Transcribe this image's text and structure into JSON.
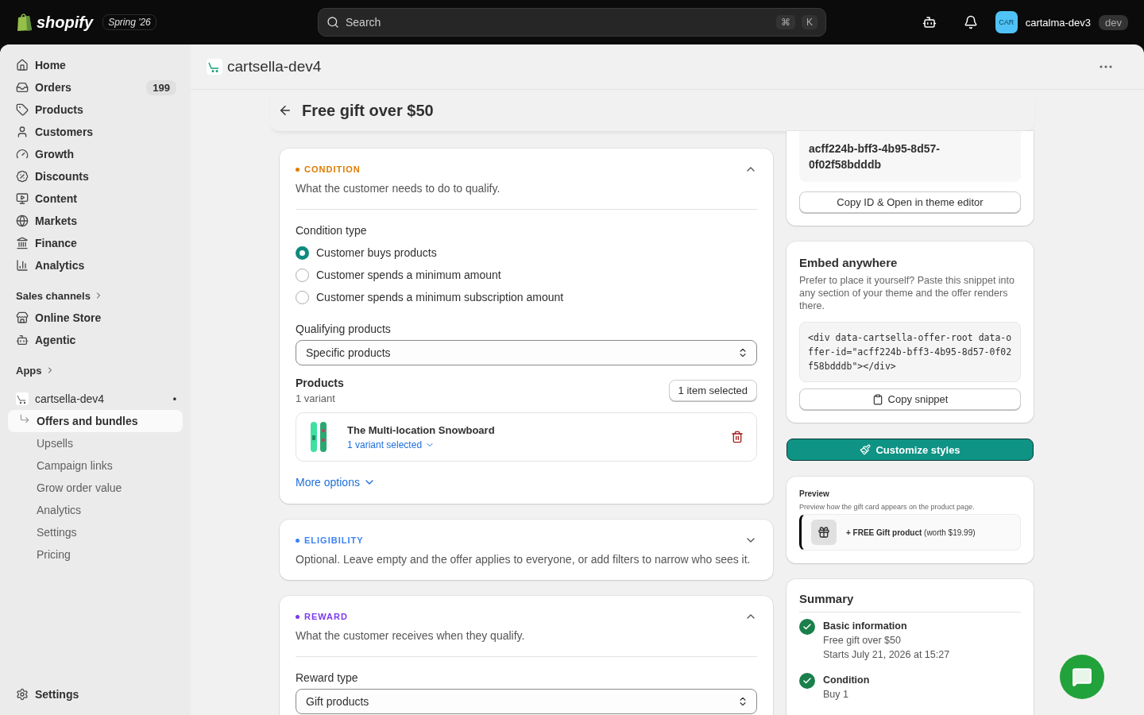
{
  "topbar": {
    "logo_text": "shopify",
    "edition": "Spring '26",
    "search": {
      "placeholder": "Search"
    },
    "shortcut": [
      "⌘",
      "K"
    ],
    "account": {
      "initials": "CAR",
      "store": "cartalma-dev3",
      "badge": "dev"
    }
  },
  "sidebar": {
    "items": [
      {
        "label": "Home"
      },
      {
        "label": "Orders",
        "badge": "199"
      },
      {
        "label": "Products"
      },
      {
        "label": "Customers"
      },
      {
        "label": "Growth"
      },
      {
        "label": "Discounts"
      },
      {
        "label": "Content"
      },
      {
        "label": "Markets"
      },
      {
        "label": "Finance"
      },
      {
        "label": "Analytics"
      }
    ],
    "sales_channels": {
      "heading": "Sales channels",
      "items": [
        {
          "label": "Online Store"
        },
        {
          "label": "Agentic"
        }
      ]
    },
    "apps": {
      "heading": "Apps",
      "app": {
        "name": "cartsella-dev4",
        "dot": "•"
      },
      "children": [
        {
          "label": "Offers and bundles",
          "selected": true
        },
        {
          "label": "Upsells",
          "selected": false
        },
        {
          "label": "Campaign links",
          "selected": false
        },
        {
          "label": "Grow order value",
          "selected": false
        },
        {
          "label": "Analytics",
          "selected": false
        },
        {
          "label": "Settings",
          "selected": false
        },
        {
          "label": "Pricing",
          "selected": false
        }
      ]
    },
    "footer": {
      "label": "Settings"
    }
  },
  "app_header": {
    "title": "cartsella-dev4"
  },
  "page": {
    "title": "Free gift over $50"
  },
  "sections": [
    {
      "kind": "condition",
      "label": "CONDITION",
      "color": "#e07b00",
      "expanded": true,
      "description": "What the customer needs to do to qualify.",
      "condition_type": {
        "label": "Condition type",
        "options": [
          {
            "label": "Customer buys products",
            "selected": true
          },
          {
            "label": "Customer spends a minimum amount",
            "selected": false
          },
          {
            "label": "Customer spends a minimum subscription amount",
            "selected": false
          }
        ]
      },
      "qualifying": {
        "label": "Qualifying products",
        "value": "Specific products"
      },
      "products": {
        "heading": "Products",
        "count": "1 variant",
        "button": "1 item selected",
        "items": [
          {
            "name": "The Multi-location Snowboard",
            "variant": "1 variant selected"
          }
        ]
      },
      "more_options": "More options"
    },
    {
      "kind": "eligibility",
      "label": "ELIGIBILITY",
      "color": "#3b82f6",
      "expanded": false,
      "description": "Optional. Leave empty and the offer applies to everyone, or add filters to narrow who sees it."
    },
    {
      "kind": "reward",
      "label": "REWARD",
      "color": "#7c3aed",
      "expanded": true,
      "description": "What the customer receives when they qualify.",
      "reward_type": {
        "label": "Reward type",
        "value": "Gift products"
      }
    }
  ],
  "theme_block": {
    "offer_id": "acff224b-bff3-4b95-8d57-0f02f58bdddb",
    "button": "Copy ID & Open in theme editor"
  },
  "embed": {
    "title": "Embed anywhere",
    "description": "Prefer to place it yourself? Paste this snippet into any section of your theme and the offer renders there.",
    "snippet": "<div data-cartsella-offer-root data-offer-id=\"acff224b-bff3-4b95-8d57-0f02f58bdddb\"></div>",
    "button": "Copy snippet"
  },
  "customize": {
    "label": "Customize styles"
  },
  "preview": {
    "title": "Preview",
    "description": "Preview how the gift card appears on the product page.",
    "gift_text": "**+ FREE Gift product** (worth $19.99)"
  },
  "summary": {
    "title": "Summary",
    "steps": [
      {
        "title": "Basic information",
        "done": true,
        "lines": [
          "Free gift over $50",
          "Starts July 21, 2026 at 15:27"
        ]
      },
      {
        "title": "Condition",
        "done": true,
        "lines": [
          "Buy 1"
        ]
      }
    ]
  }
}
